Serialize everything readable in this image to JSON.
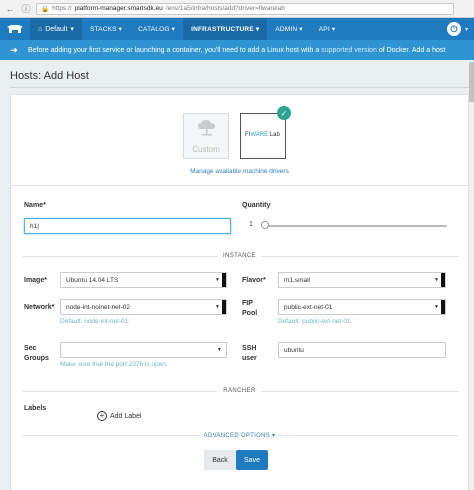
{
  "browser": {
    "url_prefix": "https://",
    "url_host": "platform-manager.smartsdk.eu",
    "url_path": "/env/1a5/infra/hosts/add?driver=fiwarelab"
  },
  "topnav": {
    "environment": "Default",
    "items": [
      {
        "label": "STACKS",
        "active": false
      },
      {
        "label": "CATALOG",
        "active": false
      },
      {
        "label": "INFRASTRUCTURE",
        "active": true
      },
      {
        "label": "ADMIN",
        "active": false
      },
      {
        "label": "API",
        "active": false
      }
    ]
  },
  "banner": {
    "text_before": "Before adding your first service or launching a container, you'll need to add a Linux host with a",
    "link_version": "supported version",
    "text_middle": "of Docker.",
    "link_add": "Add a host"
  },
  "page": {
    "title": "Hosts: Add Host"
  },
  "drivers": {
    "custom_label": "Custom",
    "fiware_brand": "FI",
    "fiware_mid": "WARE",
    "fiware_suffix": "Lab",
    "manage_link": "Manage available machine drivers"
  },
  "form": {
    "name_label": "Name*",
    "name_value": "h1|",
    "quantity_label": "Quantity",
    "quantity_value": "1",
    "quantity_level": 0.0,
    "section_instance": "INSTANCE",
    "image_label": "Image*",
    "image_value": "Ubuntu 14.04 LTS",
    "flavor_label": "Flavor*",
    "flavor_value": "m1.small",
    "network_label": "Network*",
    "network_value": "node-int-noinet-net-02",
    "network_hint": "Default: node-int-net-01.",
    "fip_label_1": "FIP",
    "fip_label_2": "Pool",
    "fip_value": "public-ext-net-01",
    "fip_hint": "Default: public-ext-net-01.",
    "sec_label_1": "Sec",
    "sec_label_2": "Groups",
    "sec_value": "",
    "sec_hint": "Make sure that the port 2376 is open.",
    "ssh_label_1": "SSH",
    "ssh_label_2": "user",
    "ssh_value": "ubuntu",
    "section_rancher": "RANCHER",
    "labels_label": "Labels",
    "add_label": "Add Label",
    "advanced": "ADVANCED OPTIONS"
  },
  "buttons": {
    "back": "Back",
    "save": "Save"
  },
  "colors": {
    "primary": "#1f7bc0",
    "banner": "#2f95d2",
    "success": "#2fa38f"
  }
}
